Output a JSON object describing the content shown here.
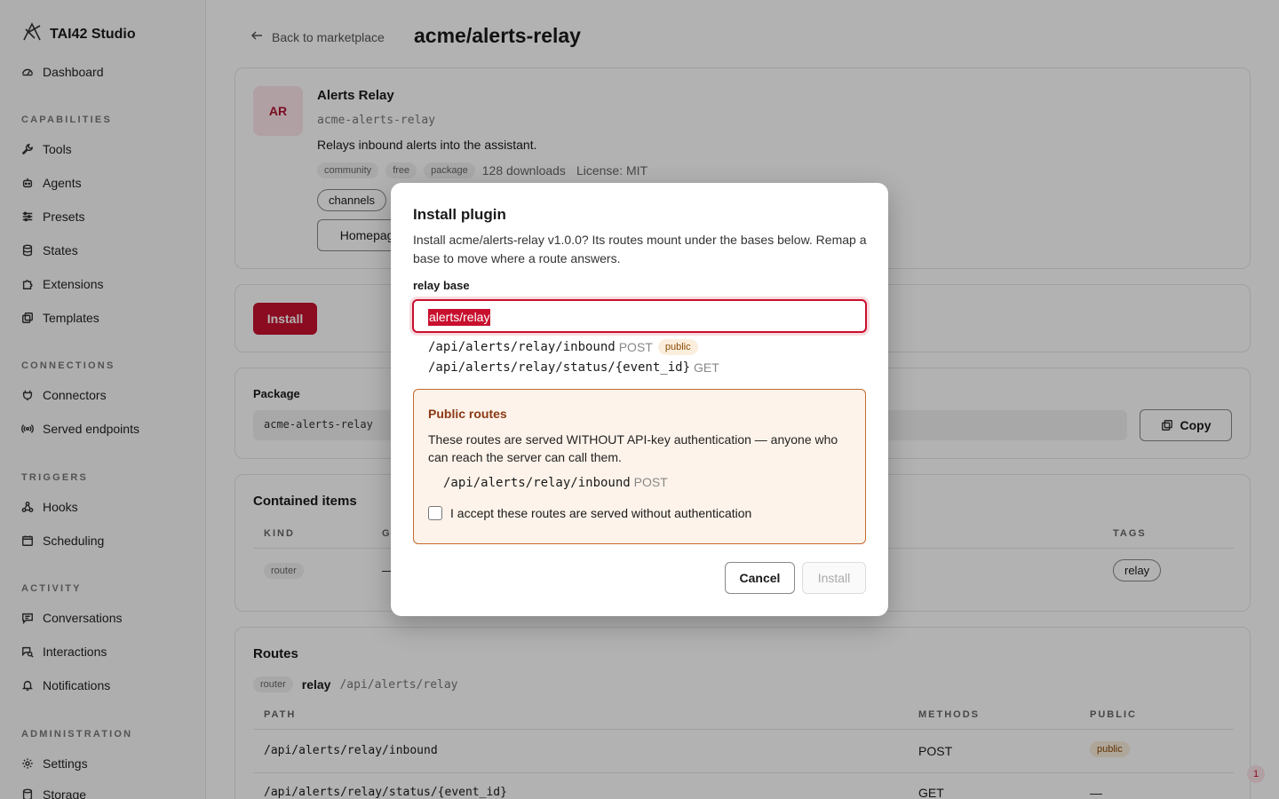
{
  "app": {
    "brand": "TAI42 Studio"
  },
  "sidebar": {
    "top": [
      {
        "label": "Dashboard",
        "icon": "gauge-icon"
      }
    ],
    "sections": [
      {
        "title": "CAPABILITIES",
        "items": [
          {
            "label": "Tools",
            "icon": "wrench-icon"
          },
          {
            "label": "Agents",
            "icon": "bot-icon"
          },
          {
            "label": "Presets",
            "icon": "sliders-icon"
          },
          {
            "label": "States",
            "icon": "database-icon"
          },
          {
            "label": "Extensions",
            "icon": "puzzle-icon"
          },
          {
            "label": "Templates",
            "icon": "copy-icon"
          }
        ]
      },
      {
        "title": "CONNECTIONS",
        "items": [
          {
            "label": "Connectors",
            "icon": "plug-icon"
          },
          {
            "label": "Served endpoints",
            "icon": "broadcast-icon"
          }
        ]
      },
      {
        "title": "TRIGGERS",
        "items": [
          {
            "label": "Hooks",
            "icon": "webhook-icon"
          },
          {
            "label": "Scheduling",
            "icon": "calendar-icon"
          }
        ]
      },
      {
        "title": "ACTIVITY",
        "items": [
          {
            "label": "Conversations",
            "icon": "message-icon"
          },
          {
            "label": "Interactions",
            "icon": "chat-search-icon"
          },
          {
            "label": "Notifications",
            "icon": "bell-icon"
          }
        ]
      },
      {
        "title": "ADMINISTRATION",
        "items": [
          {
            "label": "Settings",
            "icon": "gear-icon"
          },
          {
            "label": "Storage",
            "icon": "database-icon"
          }
        ]
      }
    ]
  },
  "header": {
    "back_label": "Back to marketplace",
    "title": "acme/alerts-relay"
  },
  "plugin": {
    "avatar": "AR",
    "name": "Alerts Relay",
    "slug": "acme-alerts-relay",
    "description": "Relays inbound alerts into the assistant.",
    "chips": [
      "community",
      "free",
      "package"
    ],
    "downloads": "128 downloads",
    "license": "License: MIT",
    "tag": "channels",
    "homepage_label": "Homepage"
  },
  "install_card": {
    "button": "Install"
  },
  "package_card": {
    "label": "Package",
    "value": "acme-alerts-relay",
    "copy_label": "Copy"
  },
  "contained": {
    "title": "Contained items",
    "headers": {
      "kind": "KIND",
      "g": "G",
      "tags": "TAGS"
    },
    "row": {
      "kind": "router",
      "g": "—",
      "tag": "relay"
    }
  },
  "routes_card": {
    "title": "Routes",
    "kind": "router",
    "name": "relay",
    "base": "/api/alerts/relay",
    "headers": {
      "path": "PATH",
      "methods": "METHODS",
      "public": "PUBLIC"
    },
    "rows": [
      {
        "path": "/api/alerts/relay/inbound",
        "method": "POST",
        "public": "public"
      },
      {
        "path": "/api/alerts/relay/status/{event_id}",
        "method": "GET",
        "public": "—"
      }
    ]
  },
  "notification_count": "1",
  "modal": {
    "title": "Install plugin",
    "description": "Install acme/alerts-relay v1.0.0? Its routes mount under the bases below. Remap a base to move where a route answers.",
    "field_label": "relay base",
    "field_value": "alerts/relay",
    "routes": [
      {
        "path": "/api/alerts/relay/inbound",
        "method": "POST",
        "badge": "public"
      },
      {
        "path": "/api/alerts/relay/status/{event_id}",
        "method": "GET",
        "badge": ""
      }
    ],
    "warning": {
      "title": "Public routes",
      "text": "These routes are served WITHOUT API-key authentication — anyone who can reach the server can call them.",
      "route_path": "/api/alerts/relay/inbound",
      "route_method": "POST",
      "checkbox_label": "I accept these routes are served without authentication",
      "checked": false
    },
    "cancel_label": "Cancel",
    "install_label": "Install"
  },
  "colors": {
    "accent": "#c8102e",
    "warning_bg": "#fdf3ea",
    "warning_border": "#c46a2d"
  }
}
